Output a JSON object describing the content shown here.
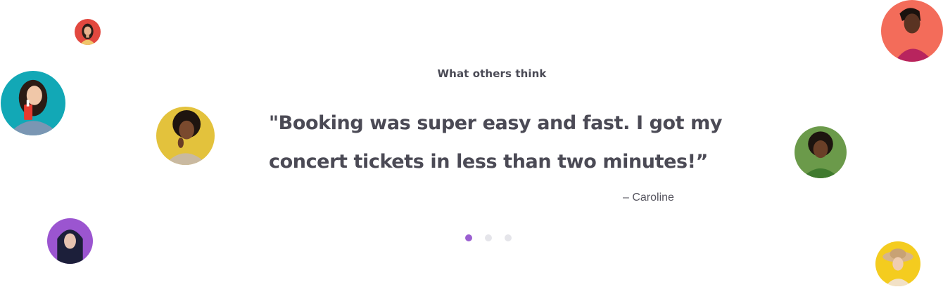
{
  "testimonials": {
    "eyebrow": "What others think",
    "quote": "\"Booking was super easy and fast. I got my concert tickets in less than two minutes!”",
    "author": "– Caroline",
    "active_slide": 1,
    "slide_count": 3
  },
  "colors": {
    "accent": "#9b5fd1",
    "dot_inactive": "#e5e5ea",
    "text": "#4b4a55"
  },
  "avatars": [
    {
      "name": "avatar-red-small",
      "bg": "#e2483f"
    },
    {
      "name": "avatar-teal",
      "bg": "#12a8b6"
    },
    {
      "name": "avatar-yellow-left",
      "bg": "#e3c23c"
    },
    {
      "name": "avatar-purple",
      "bg": "#9b55d0"
    },
    {
      "name": "avatar-coral",
      "bg": "#f36c5a"
    },
    {
      "name": "avatar-green",
      "bg": "#6b9a4a"
    },
    {
      "name": "avatar-yellow-right",
      "bg": "#f4cc1f"
    }
  ]
}
